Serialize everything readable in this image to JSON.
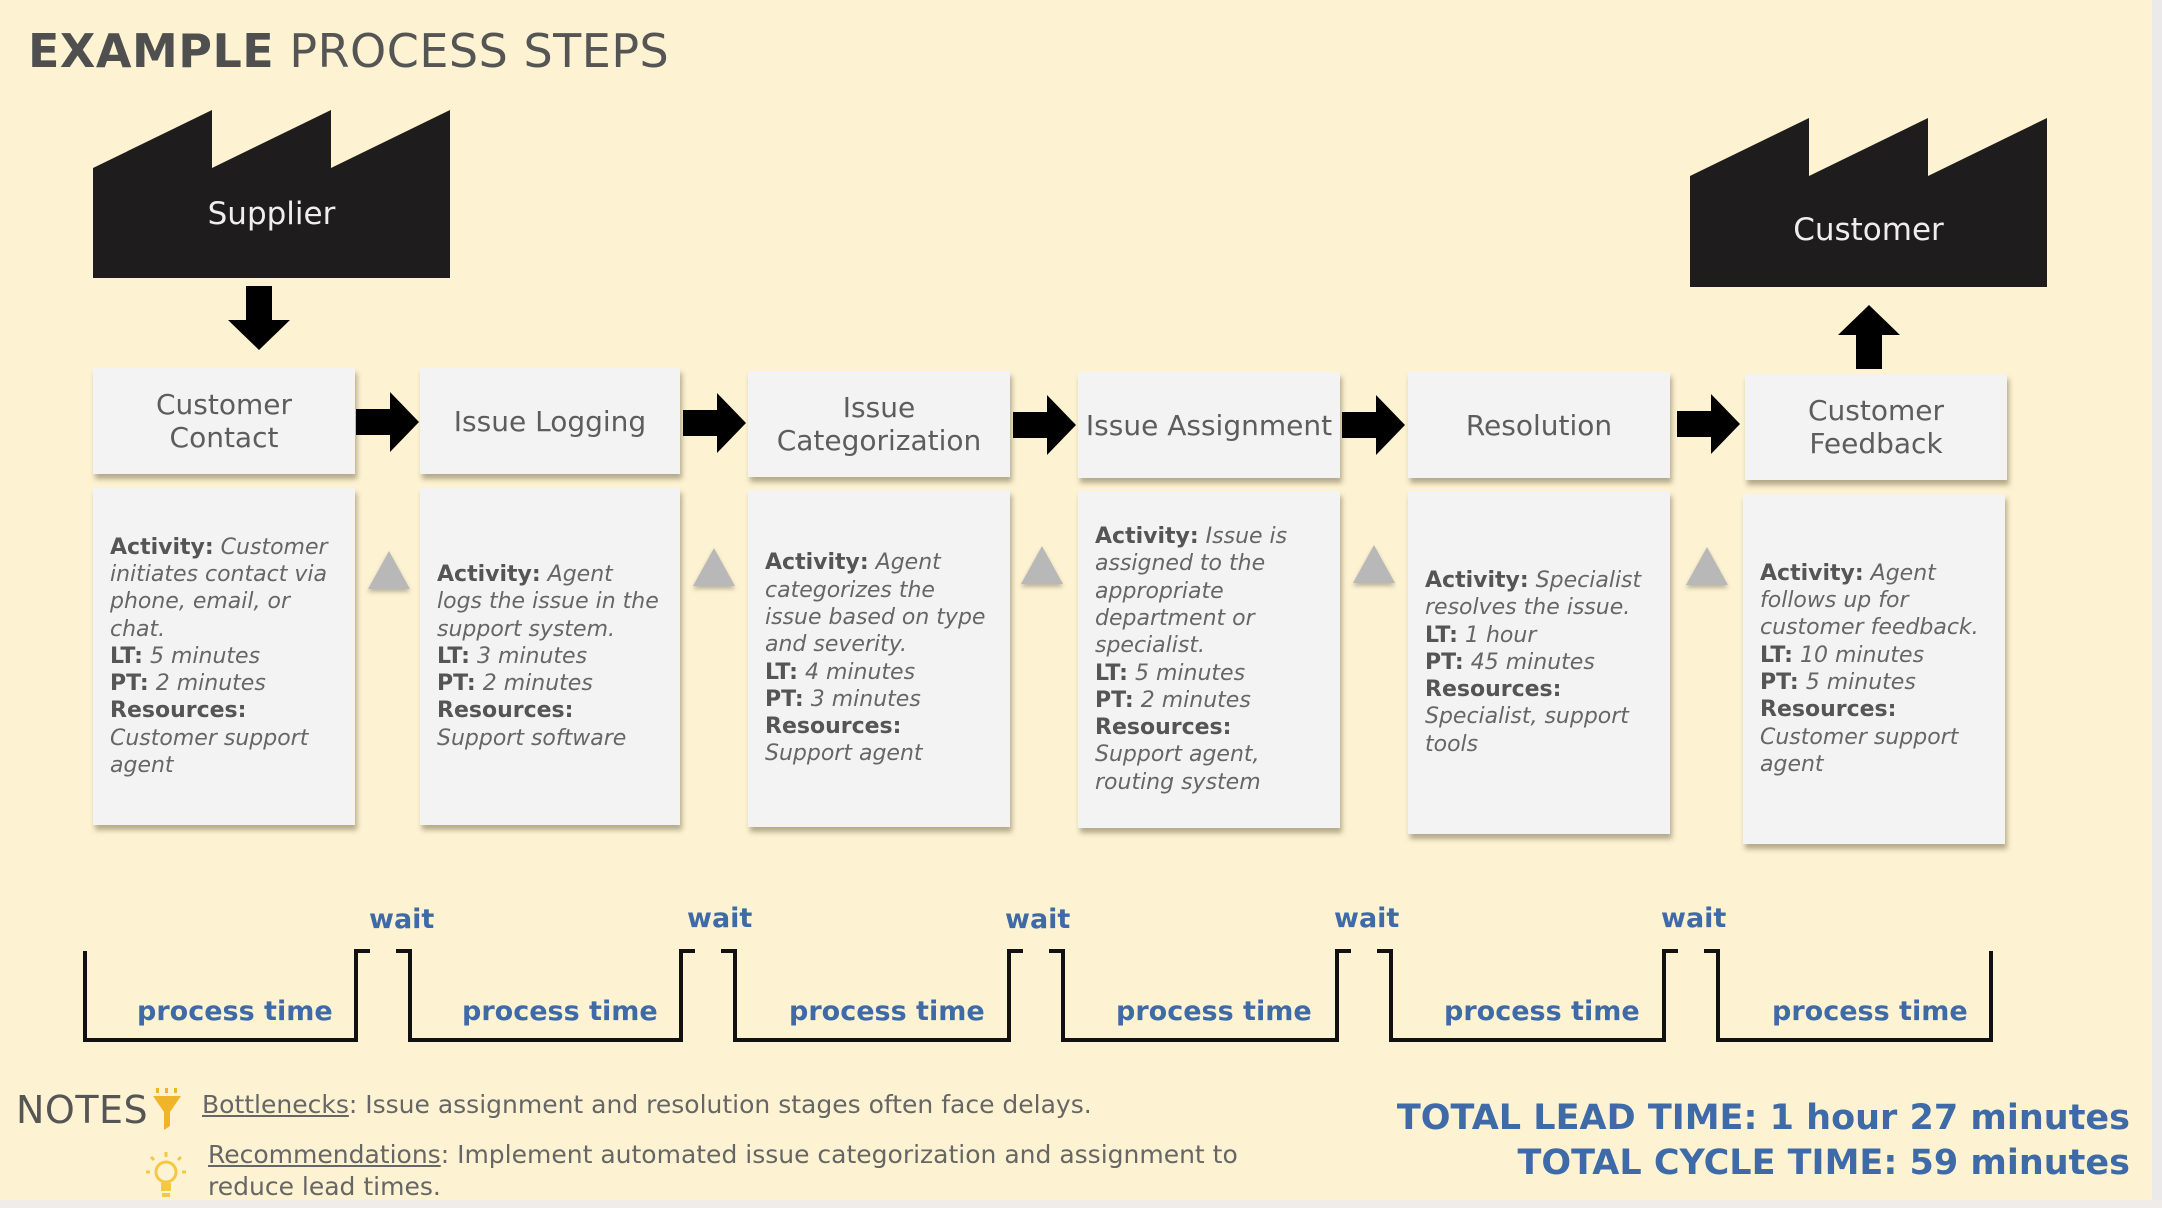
{
  "title": {
    "bold": "EXAMPLE",
    "light": "PROCESS STEPS"
  },
  "supplier": {
    "label": "Supplier",
    "icon": "factory-icon"
  },
  "customer": {
    "label": "Customer",
    "icon": "factory-icon"
  },
  "steps": [
    {
      "name": "Customer Contact",
      "line1": "Customer",
      "line2": "Contact",
      "activity": "Customer initiates contact via phone, email, or chat.",
      "lt": "5 minutes",
      "pt": "2 minutes",
      "resources": "Customer support agent"
    },
    {
      "name": "Issue Logging",
      "line1": "Issue Logging",
      "line2": "",
      "activity": "Agent logs the issue in the support system.",
      "lt": "3 minutes",
      "pt": "2 minutes",
      "resources": "Support software"
    },
    {
      "name": "Issue Categorization",
      "line1": "Issue",
      "line2": "Categorization",
      "activity": "Agent categorizes the issue based on type and severity.",
      "lt": "4 minutes",
      "pt": "3 minutes",
      "resources": "Support agent"
    },
    {
      "name": "Issue Assignment",
      "line1": "Issue Assignment",
      "line2": "",
      "activity": "Issue is assigned to the appropriate department or specialist.",
      "lt": "5 minutes",
      "pt": "2 minutes",
      "resources": "Support agent, routing system"
    },
    {
      "name": "Resolution",
      "line1": "Resolution",
      "line2": "",
      "activity": "Specialist resolves the issue.",
      "lt": "1 hour",
      "pt": "45 minutes",
      "resources": "Specialist, support tools"
    },
    {
      "name": "Customer Feedback",
      "line1": "Customer",
      "line2": "Feedback",
      "activity": "Agent follows up for customer feedback.",
      "lt": "10 minutes",
      "pt": "5 minutes",
      "resources": "Customer support agent"
    }
  ],
  "detail_labels": {
    "activity": "Activity:",
    "lt": "LT:",
    "pt": "PT:",
    "resources": "Resources:"
  },
  "inventory_icon": "triangle-inventory-icon",
  "timeline": {
    "process_label": "process time",
    "wait_label": "wait"
  },
  "notes": {
    "title": "NOTES",
    "bottlenecks_label": "Bottlenecks",
    "bottlenecks_text": ": Issue assignment and resolution stages often face delays.",
    "recommendations_label": "Recommendations",
    "recommendations_text_1": ":  Implement automated issue categorization and assignment to",
    "recommendations_text_2": "reduce lead times.",
    "bottleneck_icon": "funnel-icon",
    "recommendation_icon": "lightbulb-icon"
  },
  "totals": {
    "lead_time": "TOTAL LEAD TIME: 1 hour 27 minutes",
    "cycle_time": "TOTAL CYCLE TIME: 59 minutes"
  },
  "colors": {
    "background": "#fdf3d2",
    "accent_blue": "#3e6aa8",
    "box": "#f3f3f3",
    "factory": "#1e1c1c",
    "icon_yellow": "#f0b429"
  }
}
